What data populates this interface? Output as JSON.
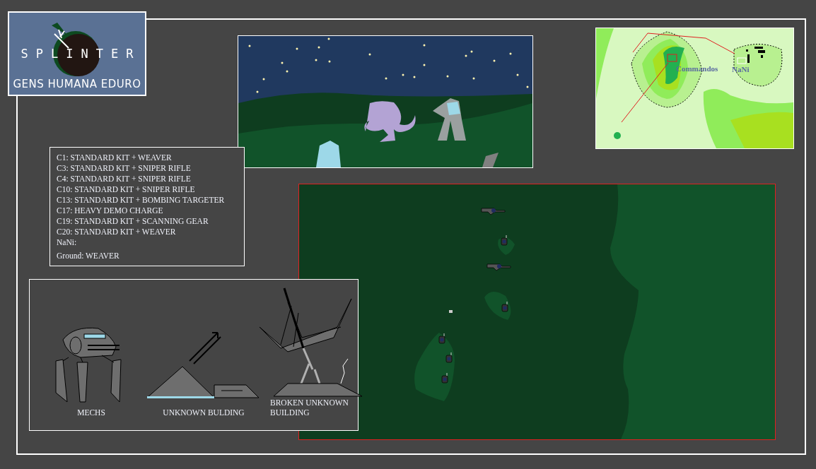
{
  "logo": {
    "title": "SPLINTER",
    "motto": "GENS HUMANA EDURO"
  },
  "roster": [
    "C1: STANDARD KIT + WEAVER",
    "C3: STANDARD KIT + SNIPER RIFLE",
    "C4: STANDARD KIT + SNIPER RIFLE",
    "C10: STANDARD KIT + SNIPER RIFLE",
    "C13: STANDARD KIT + BOMBING TARGETER",
    "C17: HEAVY DEMO CHARGE",
    "C19: STANDARD KIT + SCANNING GEAR",
    "C20: STANDARD KIT + WEAVER",
    "NaNi:",
    "Ground: WEAVER"
  ],
  "minimap": {
    "labels": [
      {
        "text": "Commandos"
      },
      {
        "text": "NaNi"
      }
    ]
  },
  "legend": [
    {
      "kind": "mech",
      "label": "MECHS"
    },
    {
      "kind": "building",
      "label": "UNKNOWN BULDING"
    },
    {
      "kind": "broken-building",
      "label": "BROKEN UNKNOWN BUILDING"
    }
  ]
}
